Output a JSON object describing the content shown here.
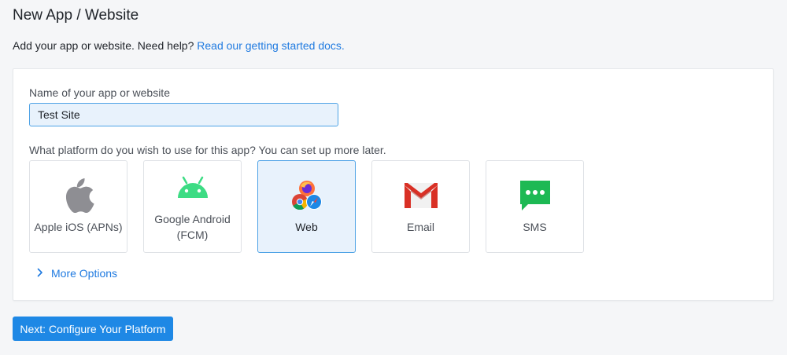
{
  "header": {
    "title": "New App / Website",
    "help_text": "Add your app or website. Need help? ",
    "help_link": "Read our getting started docs."
  },
  "form": {
    "name_label": "Name of your app or website",
    "name_value": "Test Site",
    "platform_label": "What platform do you wish to use for this app? You can set up more later.",
    "platforms": [
      {
        "label": "Apple iOS (APNs)",
        "icon": "apple-icon",
        "selected": false
      },
      {
        "label": "Google Android (FCM)",
        "icon": "android-icon",
        "selected": false
      },
      {
        "label": "Web",
        "icon": "browsers-icon",
        "selected": true
      },
      {
        "label": "Email",
        "icon": "gmail-icon",
        "selected": false
      },
      {
        "label": "SMS",
        "icon": "sms-chat-icon",
        "selected": false
      }
    ],
    "more_options": "More Options"
  },
  "footer": {
    "next_label": "Next: Configure Your Platform"
  },
  "colors": {
    "accent": "#1e88e5",
    "link": "#1f7ae0",
    "selected_bg": "#e8f2fc",
    "android_green": "#3ddc84",
    "gmail_red": "#d93025",
    "sms_green": "#1db954"
  }
}
